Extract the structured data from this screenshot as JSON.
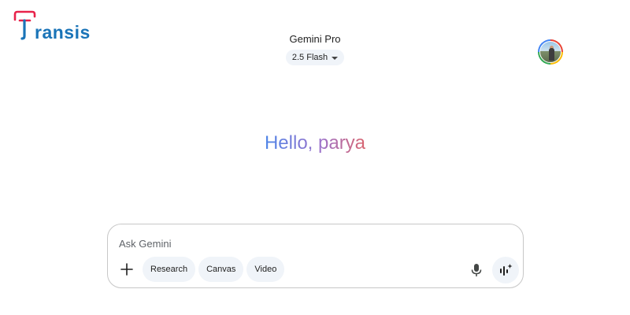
{
  "logo": {
    "text": "ransis",
    "icon": "transis-t-logo",
    "colors": {
      "accent_red": "#e8224a",
      "brand_blue": "#1a74b8"
    }
  },
  "header": {
    "model_title": "Gemini Pro",
    "model_picker": {
      "selected": "2.5 Flash",
      "icon": "chevron-down-icon"
    }
  },
  "account": {
    "avatar_icon": "user-avatar"
  },
  "main": {
    "greeting": "Hello, parya"
  },
  "composer": {
    "placeholder": "Ask Gemini",
    "value": "",
    "add_icon": "plus-icon",
    "chips": [
      {
        "label": "Research"
      },
      {
        "label": "Canvas"
      },
      {
        "label": "Video"
      }
    ],
    "mic_icon": "microphone-icon",
    "live_icon": "live-sparkle-icon"
  }
}
